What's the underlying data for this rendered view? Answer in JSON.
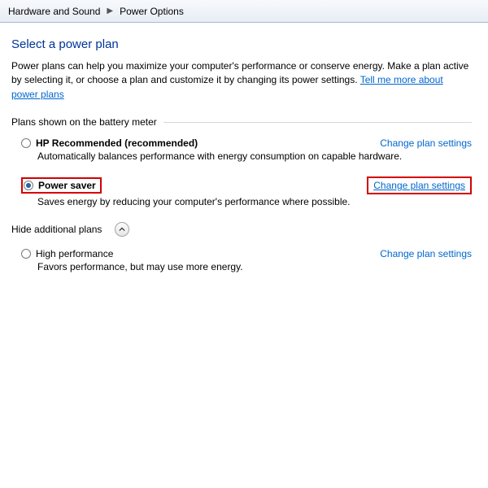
{
  "breadcrumb": {
    "parent": "Hardware and Sound",
    "current": "Power Options"
  },
  "title": "Select a power plan",
  "intro_text": "Power plans can help you maximize your computer's performance or conserve energy. Make a plan active by selecting it, or choose a plan and customize it by changing its power settings. ",
  "intro_link": "Tell me more about power plans",
  "section_label": "Plans shown on the battery meter",
  "additional_label": "Hide additional plans",
  "change_link_text": "Change plan settings",
  "plans": {
    "recommended": {
      "name": "HP Recommended (recommended)",
      "desc": "Automatically balances performance with energy consumption on capable hardware."
    },
    "power_saver": {
      "name": "Power saver",
      "desc": "Saves energy by reducing your computer's performance where possible."
    },
    "high_perf": {
      "name": "High performance",
      "desc": "Favors performance, but may use more energy."
    }
  }
}
